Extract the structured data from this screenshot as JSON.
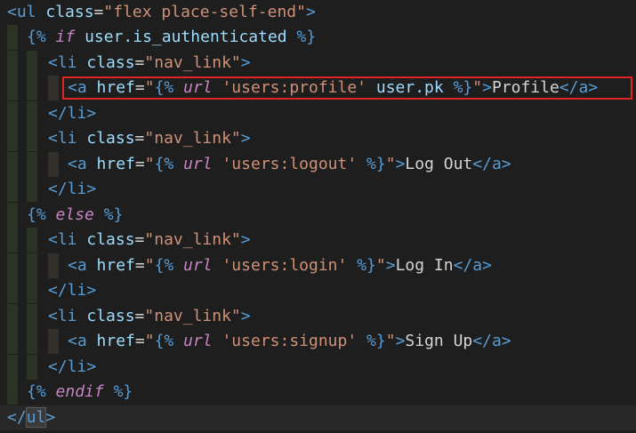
{
  "editor": {
    "language": "html-django",
    "colors": {
      "background": "#1e1e1e",
      "tag": "#569cd6",
      "attribute": "#9cdcfe",
      "string": "#ce9178",
      "keyword": "#c586c0",
      "highlight_box": "#e02424"
    },
    "tokens": {
      "ul_open": "<ul",
      "ul_close_open": "</",
      "ul_close_name": "ul",
      "gt": ">",
      "li_open": "<li",
      "li_close": "</li>",
      "a_open": "<a",
      "a_close": "</a>",
      "class_attr": "class",
      "href_attr": "href",
      "eq": "=",
      "ul_class_value": "\"flex place-self-end\"",
      "li_class_value": "\"nav_link\"",
      "quote_open": "\"",
      "quote_close": "\"",
      "tpl_open": "{%",
      "tpl_close": "%}",
      "kw_if": "if",
      "kw_else": "else",
      "kw_endif": "endif",
      "kw_url": "url",
      "cond_var": "user.is_authenticated",
      "pk_var": "user.pk",
      "url_profile": "'users:profile'",
      "url_logout": "'users:logout'",
      "url_login": "'users:login'",
      "url_signup": "'users:signup'",
      "link_profile": "Profile",
      "link_logout": "Log Out",
      "link_login": "Log In",
      "link_signup": "Sign Up"
    }
  }
}
